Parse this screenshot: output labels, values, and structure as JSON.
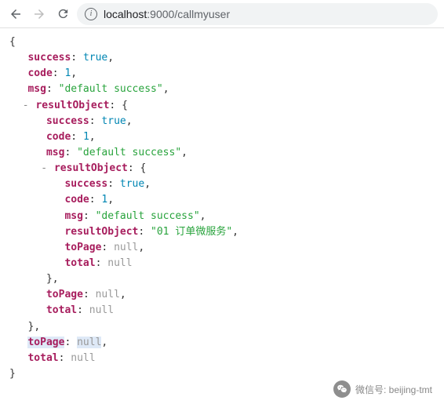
{
  "address": {
    "host": "localhost",
    "port": ":9000",
    "path": "/callmyuser"
  },
  "json": {
    "success": true,
    "code": 1,
    "msg": "default success",
    "resultObject": {
      "success": true,
      "code": 1,
      "msg": "default success",
      "resultObject": {
        "success": true,
        "code": 1,
        "msg": "default success",
        "resultObject": "01 订单微服务",
        "toPage": null,
        "total": null
      },
      "toPage": null,
      "total": null
    },
    "toPage": null,
    "total": null
  },
  "watermark": {
    "label": "微信号",
    "value": "beijing-tmt"
  }
}
